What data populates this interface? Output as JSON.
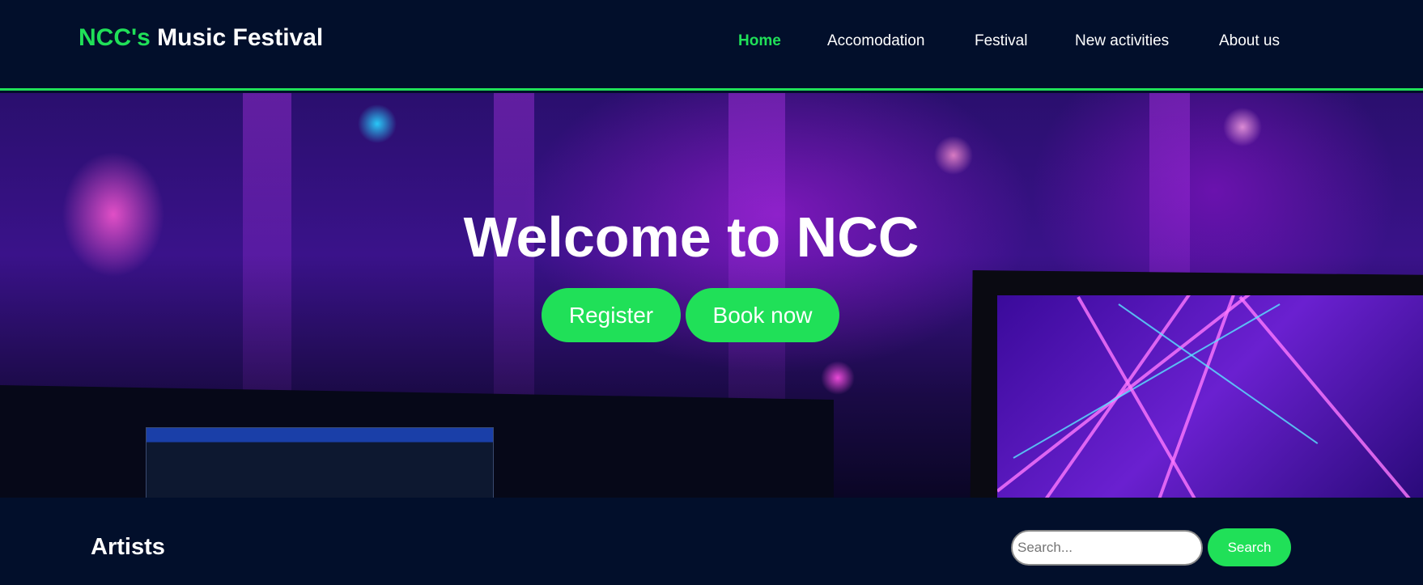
{
  "header": {
    "logo_accent": "NCC's",
    "logo_rest": " Music Festival",
    "nav": [
      {
        "label": "Home",
        "active": true
      },
      {
        "label": "Accomodation",
        "active": false
      },
      {
        "label": "Festival",
        "active": false
      },
      {
        "label": "New activities",
        "active": false
      },
      {
        "label": "About us",
        "active": false
      }
    ]
  },
  "hero": {
    "title": "Welcome to NCC",
    "register_label": "Register",
    "book_label": "Book now",
    "background": "concert-stage-photo"
  },
  "artists": {
    "title": "Artists",
    "search_placeholder": "Search...",
    "search_value": "",
    "search_button": "Search"
  },
  "colors": {
    "background": "#020f2b",
    "accent": "#20e058",
    "text": "#ffffff"
  }
}
